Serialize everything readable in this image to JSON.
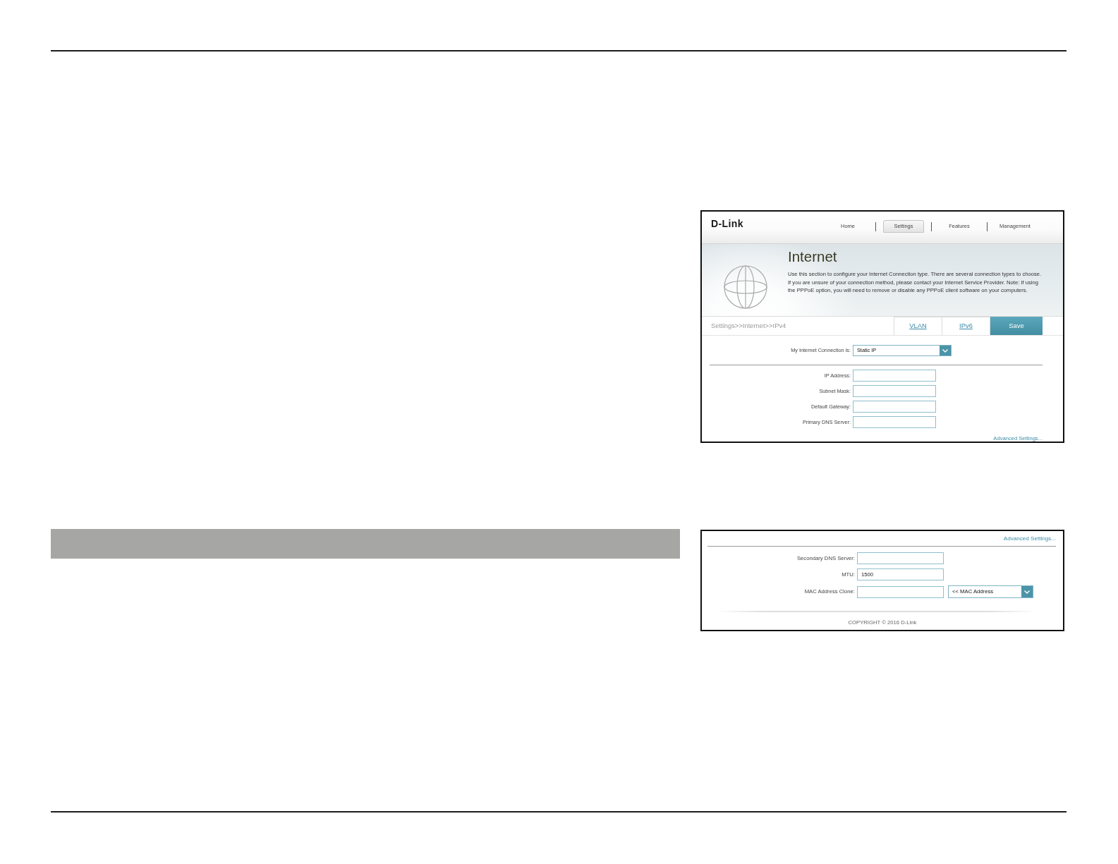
{
  "screenshots": [
    {
      "header": {
        "logo": "D-Link",
        "nav": [
          {
            "label": "Home",
            "selected": false
          },
          {
            "label": "Settings",
            "selected": true
          },
          {
            "label": "Features",
            "selected": false
          },
          {
            "label": "Management",
            "selected": false
          }
        ]
      },
      "banner": {
        "title": "Internet",
        "description": "Use this section to configure your Internet Connection type. There are several connection types to choose. If you are unsure of your connection method, please contact your Internet Service Provider. Note: If using the PPPoE option, you will need to remove or disable any PPPoE client software on your computers."
      },
      "toolbar": {
        "breadcrumb": "Settings>>Internet>>IPv4",
        "links": [
          "VLAN",
          "IPv6"
        ],
        "save_button": "Save"
      },
      "rows": [
        {
          "kind": "select",
          "label": "My Internet Connection is:",
          "value": "Static IP"
        },
        {
          "kind": "divider"
        },
        {
          "kind": "input",
          "label": "IP Address:"
        },
        {
          "kind": "input",
          "label": "Subnet Mask:"
        },
        {
          "kind": "input",
          "label": "Default Gateway:"
        },
        {
          "kind": "input",
          "label": "Primary DNS Server:"
        },
        {
          "kind": "link",
          "text": "Advanced Settings..."
        }
      ]
    },
    {
      "rows": [
        {
          "kind": "link",
          "text": "Advanced Settings..."
        },
        {
          "kind": "divider"
        },
        {
          "kind": "input",
          "label": "Secondary DNS Server:"
        },
        {
          "kind": "input",
          "label": "MTU:",
          "value": "1500"
        },
        {
          "kind": "input_select",
          "label": "MAC Address Clone:",
          "option": "<< MAC Address"
        }
      ],
      "footer": "COPYRIGHT © 2016 D-Link"
    }
  ]
}
